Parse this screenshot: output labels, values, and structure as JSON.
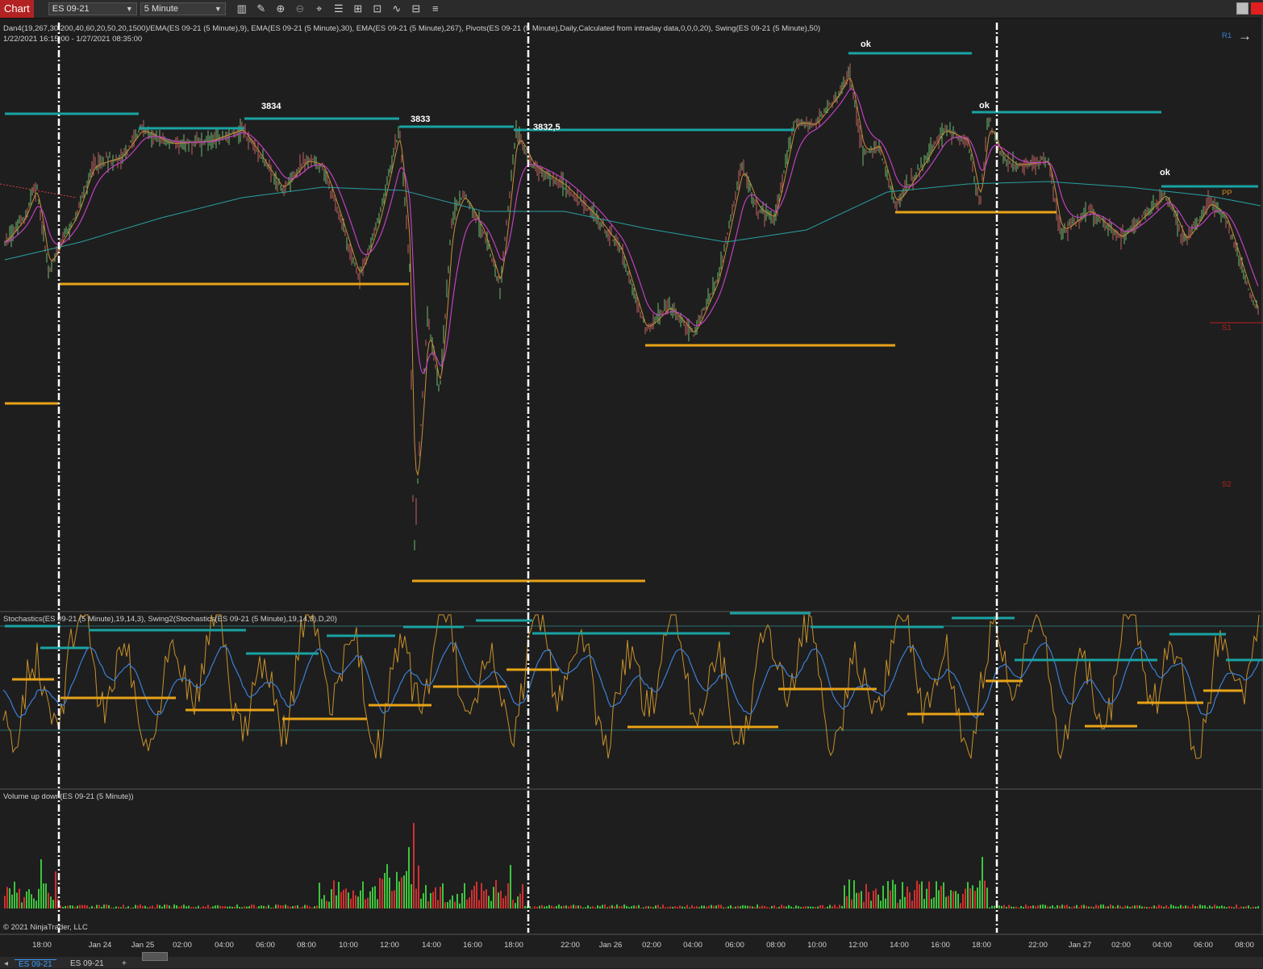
{
  "toolbar": {
    "chart_tab": "Chart",
    "instrument": "ES 09-21",
    "interval": "5 Minute",
    "tools": [
      "bar-type-icon",
      "pencil-icon",
      "zoom-in-icon",
      "zoom-out-icon",
      "crosshair-icon",
      "properties-icon",
      "indicators-icon",
      "strategies-icon",
      "chart-trader-icon",
      "templates-icon",
      "menu-icon"
    ]
  },
  "legend": {
    "indicators": "Dan4(19,267,30,200,40,60,20,50,20,1500)/EMA(ES 09-21 (5 Minute),9), EMA(ES 09-21 (5 Minute),30), EMA(ES 09-21 (5 Minute),267), Pivots(ES 09-21 (5 Minute),Daily,Calculated from intraday data,0,0,0,20), Swing(ES 09-21 (5 Minute),50)",
    "range": "1/22/2021 16:15:00 - 1/27/2021 08:35:00"
  },
  "annotations": [
    "3834",
    "3833",
    "3832,5",
    "ok",
    "ok",
    "ok"
  ],
  "pivots": {
    "r1": "R1",
    "pp": "PP",
    "s1": "S1",
    "s2": "S2"
  },
  "panels": {
    "stoch": "Stochastics(ES 09-21 (5 Minute),19,14,3), Swing2(Stochastics(ES 09-21 (5 Minute),19,14,3).D,20)",
    "volume": "Volume up down(ES 09-21 (5 Minute))",
    "copyright": "© 2021 NinjaTrader, LLC"
  },
  "time_axis": [
    "18:00",
    "Jan 24",
    "Jan 25",
    "02:00",
    "04:00",
    "06:00",
    "08:00",
    "10:00",
    "12:00",
    "14:00",
    "16:00",
    "18:00",
    "22:00",
    "Jan 26",
    "02:00",
    "04:00",
    "06:00",
    "08:00",
    "10:00",
    "12:00",
    "14:00",
    "16:00",
    "18:00",
    "22:00",
    "Jan 27",
    "02:00",
    "04:00",
    "06:00",
    "08:00"
  ],
  "bottom_tabs": [
    "ES 09-21",
    "ES 09-21",
    "+"
  ],
  "colors": {
    "background": "#1e1e1e",
    "swing_high": "#1aa3a3",
    "swing_low": "#e8a317",
    "ema9": "#c8903a",
    "ema30": "#c040c0",
    "ema267": "#2aa0a0",
    "up": "#3fc43f",
    "down": "#d03030",
    "stoch_k": "#c8902a",
    "stoch_d": "#3d7fd6"
  }
}
